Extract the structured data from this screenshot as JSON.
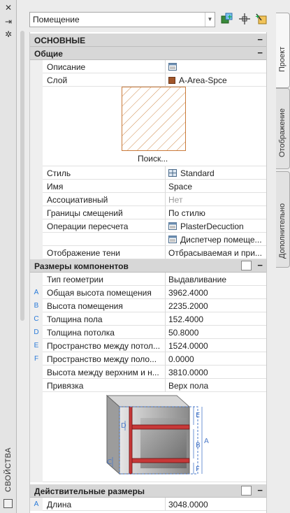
{
  "palette": {
    "title": "СВОЙСТВА"
  },
  "selector": {
    "value": "Помещение"
  },
  "tabs": [
    {
      "label": "Проект",
      "active": true
    },
    {
      "label": "Отображение",
      "active": false
    },
    {
      "label": "Дополнительно",
      "active": false
    }
  ],
  "sections": {
    "main": "ОСНОВНЫЕ",
    "general": "Общие",
    "components": "Размеры компонентов",
    "actual": "Действительные размеры"
  },
  "general_rows": {
    "description": {
      "name": "Описание",
      "value": ""
    },
    "layer": {
      "name": "Слой",
      "value": "A-Area-Spce"
    },
    "search_label": "Поиск...",
    "style": {
      "name": "Стиль",
      "value": "Standard"
    },
    "name": {
      "name": "Имя",
      "value": "Space"
    },
    "associative": {
      "name": "Ассоциативный",
      "value": "Нет"
    },
    "offset_bounds": {
      "name": "Границы смещений",
      "value": "По стилю"
    },
    "intersect_ops": {
      "name": "Операции пересчета",
      "value": "PlasterDecuction"
    },
    "dispatcher": {
      "value": "Диспетчер помеще..."
    },
    "shadow": {
      "name": "Отображение тени",
      "value": "Отбрасываемая и при..."
    }
  },
  "component_rows": [
    {
      "letter": "",
      "name": "Тип геометрии",
      "value": "Выдавливание"
    },
    {
      "letter": "A",
      "name": "Общая высота помещения",
      "value": "3962.4000"
    },
    {
      "letter": "B",
      "name": "Высота помещения",
      "value": "2235.2000"
    },
    {
      "letter": "C",
      "name": "Толщина пола",
      "value": "152.4000"
    },
    {
      "letter": "D",
      "name": "Толщина потолка",
      "value": "50.8000"
    },
    {
      "letter": "E",
      "name": "Пространство между потол...",
      "value": "1524.0000"
    },
    {
      "letter": "F",
      "name": "Пространство между поло...",
      "value": "0.0000"
    },
    {
      "letter": "",
      "name": "Высота между верхним и н...",
      "value": "3810.0000"
    },
    {
      "letter": "",
      "name": "Привязка",
      "value": "Верх пола"
    }
  ],
  "diagram_labels": {
    "a": "A",
    "b": "B",
    "c": "C",
    "d": "D",
    "e": "E",
    "f": "F"
  },
  "actual_rows": [
    {
      "letter": "A",
      "name": "Длина",
      "value": "3048.0000"
    }
  ]
}
